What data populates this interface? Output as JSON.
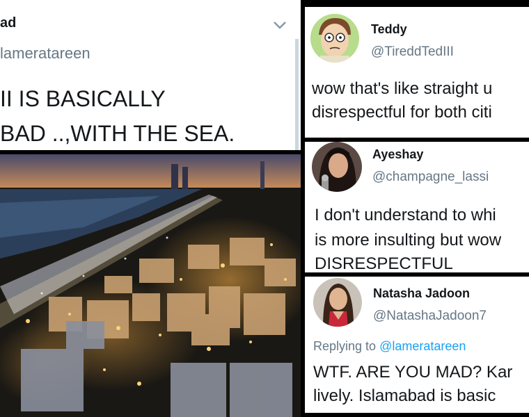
{
  "left_tweet": {
    "name": "ad",
    "handle": "lameratareen",
    "text_line1": "II IS BASICALLY",
    "text_line2": "BAD ..,WITH THE SEA.",
    "menu_icon": "chevron-down-icon"
  },
  "city_photo": {
    "icon": "city-night-photo"
  },
  "replies": [
    {
      "name": "Teddy",
      "handle": "@TireddTedIII",
      "line1": "wow that's like straight u",
      "line2": "disrespectful for both citi",
      "avatar_icon": "cartoon-avatar"
    },
    {
      "name": "Ayeshay",
      "handle": "@champagne_lassi",
      "line1": "I don't understand to whi",
      "line2": "is more insulting but wow",
      "line3": "DISRESPECTFUL",
      "avatar_icon": "photo-avatar"
    },
    {
      "name": "Natasha Jadoon",
      "handle": "@NatashaJadoon7",
      "replying_prefix": "Replying to ",
      "replying_mention": "@lameratareen",
      "line1": "WTF. ARE YOU MAD? Kar",
      "line2": "lively. Islamabad is basic",
      "avatar_icon": "photo-avatar"
    }
  ],
  "colors": {
    "background": "#000000",
    "panel": "#ffffff",
    "handle": "#657786",
    "link": "#1da1f2",
    "text": "#14171a"
  }
}
